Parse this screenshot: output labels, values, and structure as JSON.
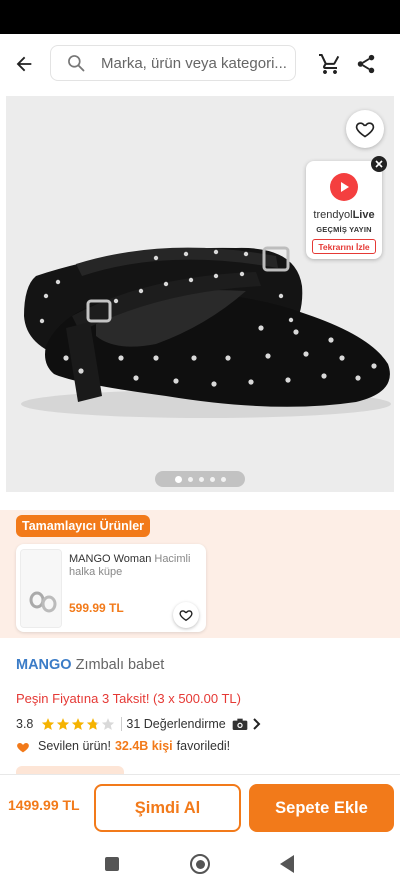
{
  "colors": {
    "accent": "#f27a1a",
    "brand_blue": "#3b7cc7",
    "installment_red": "#e53935",
    "live_red": "#f43f3f",
    "star_yellow": "#f5b301",
    "complement_bg": "#fdeee6"
  },
  "header": {
    "search_placeholder": "Marka, ürün veya kategori...",
    "icons": [
      "back-arrow-icon",
      "search-icon",
      "cart-icon",
      "share-icon"
    ]
  },
  "gallery": {
    "image_count": 5,
    "active_index": 0,
    "favorite_icon": "heart-outline-icon"
  },
  "live_widget": {
    "brand_prefix": "trendyol",
    "brand_suffix": "Live",
    "status": "GEÇMİŞ YAYIN",
    "replay_label": "Tekrarını İzle"
  },
  "complementary": {
    "badge": "Tamamlayıcı Ürünler",
    "item": {
      "brand": "MANGO Woman",
      "name": "Hacimli halka küpe",
      "price": "599.99 TL"
    }
  },
  "product": {
    "brand": "MANGO",
    "name": "Zımbalı babet",
    "installment": "Peşin Fiyatına 3 Taksit! (3 x 500.00 TL)",
    "rating": "3.8",
    "rating_value": 3.8,
    "review_count": "31 Değerlendirme",
    "fav_prefix": "Sevilen ürün!",
    "fav_count": "32.4B kişi",
    "fav_suffix": "favoriledi!"
  },
  "bottom_bar": {
    "price": "1499.99 TL",
    "buy_now": "Şimdi Al",
    "add_to_cart": "Sepete Ekle"
  }
}
